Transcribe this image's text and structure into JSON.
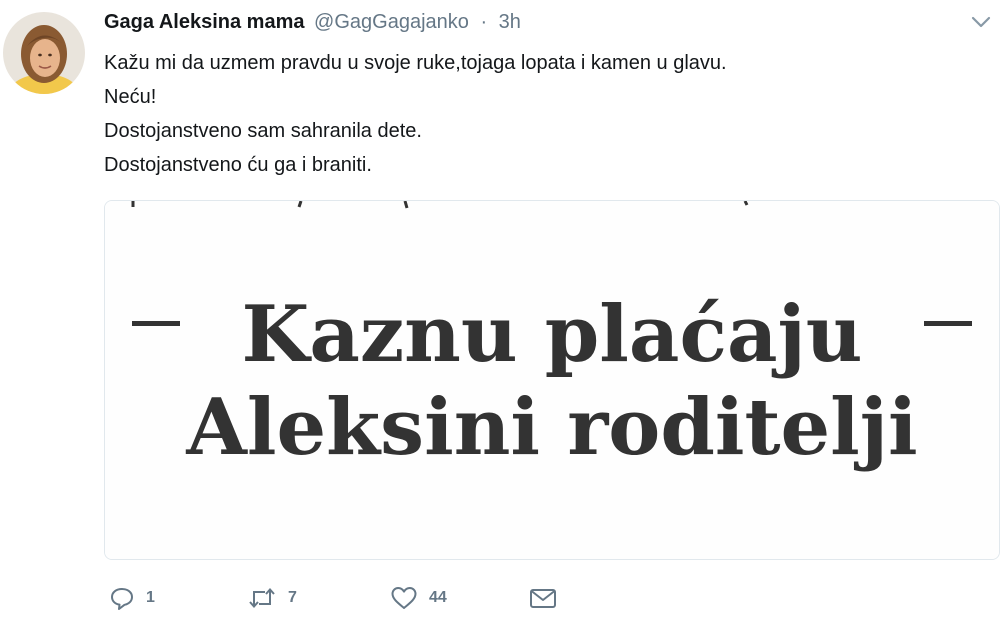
{
  "tweet": {
    "author_name": "Gaga Aleksina mama",
    "handle": "@GagGagajanko",
    "separator": "·",
    "time": "3h",
    "lines": [
      "Kažu mi da uzmem pravdu u svoje ruke,tojaga lopata i kamen u glavu.",
      "Neću!",
      "Dostojanstveno sam sahranila dete.",
      "Dostojanstveno ću ga i braniti."
    ],
    "media": {
      "line1": "Kaznu plaćaju",
      "line2": "Aleksini roditelji"
    },
    "actions": {
      "reply_count": "1",
      "retweet_count": "7",
      "like_count": "44"
    }
  },
  "icons": {
    "menu": "chevron-down-icon",
    "reply": "reply-icon",
    "retweet": "retweet-icon",
    "like": "heart-icon",
    "dm": "envelope-icon"
  },
  "colors": {
    "text": "#14171a",
    "secondary": "#657786",
    "border": "#e1e8ed",
    "media_text": "#333333"
  }
}
